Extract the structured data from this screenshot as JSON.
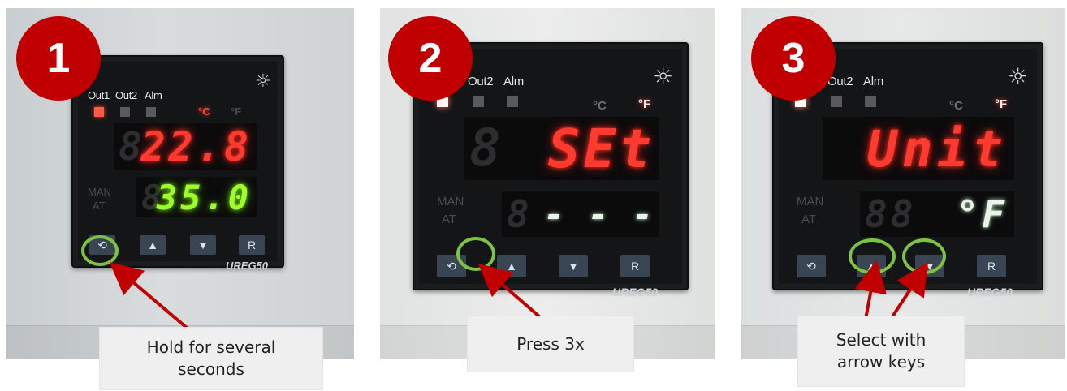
{
  "device_labels": {
    "out1": "Out1",
    "out2": "Out2",
    "alm": "Alm",
    "celsius": "°C",
    "fahrenheit": "°F",
    "man": "MAN",
    "at": "AT",
    "model": "UREG50",
    "btn_up": "▲",
    "btn_down": "▼",
    "btn_r": "R",
    "btn_cycle": "⟲"
  },
  "panels": [
    {
      "step": "1",
      "top_display": "22.8",
      "bottom_display": "35.0",
      "caption": "Hold for several seconds"
    },
    {
      "step": "2",
      "top_display": "SEt",
      "bottom_display": "- - -",
      "caption": "Press 3x"
    },
    {
      "step": "3",
      "top_display": "Unit",
      "bottom_display": "°F",
      "caption": "Select with arrow keys"
    }
  ],
  "colors": {
    "step_badge": "#c00000",
    "highlight_ring": "#7dc242",
    "arrow": "#c00000",
    "led_red": "#ff3b2f",
    "led_green": "#9dff2a"
  }
}
